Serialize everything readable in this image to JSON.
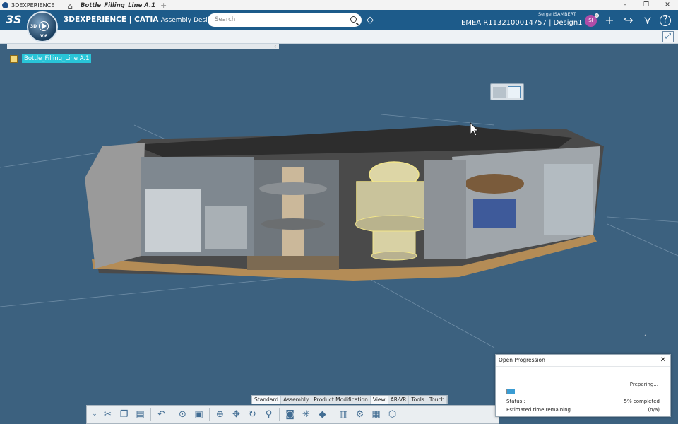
{
  "window": {
    "title": "3DEXPERIENCE",
    "min": "–",
    "max": "❐",
    "close": "✕"
  },
  "header": {
    "brand": "3DEXPERIENCE | CATIA",
    "role": "Assembly Design",
    "search_placeholder": "Search",
    "user_name": "Serge ISAMBERT",
    "tenant": "EMEA R1132100014757 | Design1 ⌄",
    "avatar_initials": "SI",
    "compass_version": "V.6",
    "compass_3d": "3D"
  },
  "tabs": {
    "active": "Bottle_Filling_Line A.1",
    "add": "+"
  },
  "tree": {
    "root": "Bottle_Filling_Line A.1"
  },
  "action_tabs": [
    "Standard",
    "Assembly",
    "Product Modification",
    "View",
    "AR-VR",
    "Tools",
    "Touch"
  ],
  "action_tab_active": "View",
  "progress_dialog": {
    "title": "Open Progression",
    "state": "Preparing...",
    "status_label": "Status :",
    "status_value": "5% completed",
    "progress": 0.05,
    "eta_label": "Estimated time remaining :",
    "eta_value": "(n/a)"
  },
  "compass_axis": "z",
  "colors": {
    "header": "#1d5b8a",
    "viewport": "#3c617f",
    "selection": "#29c5d8",
    "progress_fill": "#3a9cd3"
  }
}
